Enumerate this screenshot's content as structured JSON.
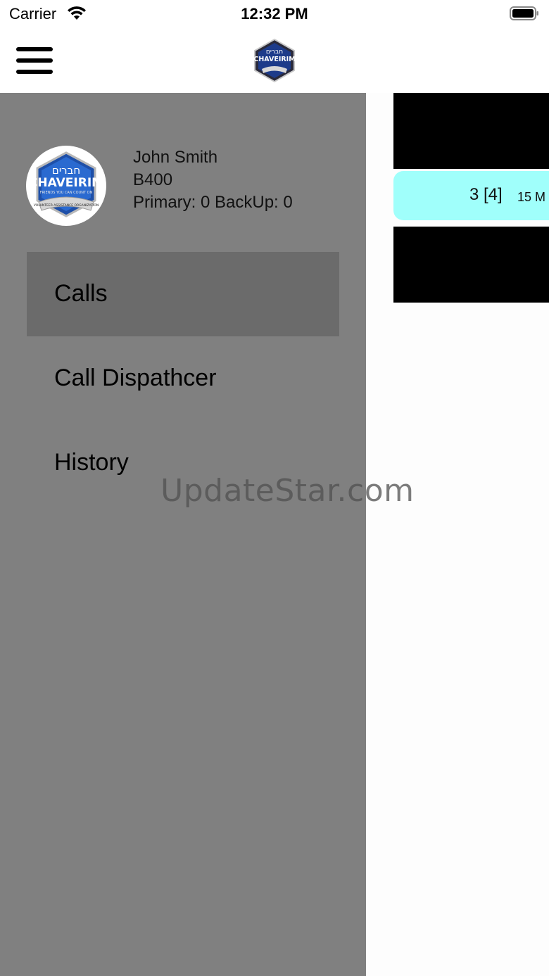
{
  "status_bar": {
    "carrier": "Carrier",
    "time": "12:32 PM",
    "wifi_icon": "wifi-icon",
    "battery_icon": "battery-icon"
  },
  "nav_bar": {
    "menu_icon": "hamburger-menu-icon",
    "logo": {
      "hebrew": "חברים",
      "name": "CHAVEIRIM"
    }
  },
  "drawer": {
    "user": {
      "name": "John Smith",
      "unit": "B400",
      "stats": "Primary: 0 BackUp: 0"
    },
    "avatar_logo": {
      "hebrew": "חברים",
      "name": "CHAVEIRIM",
      "tagline": "FRIENDS YOU CAN COUNT ON",
      "banner": "VOLUNTEER ASSISTANCE ORGANIZATION"
    },
    "menu": [
      {
        "label": "Calls",
        "active": true
      },
      {
        "label": "Call Dispathcer",
        "active": false
      },
      {
        "label": "History",
        "active": false
      }
    ]
  },
  "main": {
    "call_card": {
      "count": "3 [4]",
      "time": "15 M"
    }
  },
  "colors": {
    "drawer_bg": "#808080",
    "active_item": "#6b6b6b",
    "call_card_bg": "#a0fffb"
  },
  "watermark": "UpdateStar.com"
}
